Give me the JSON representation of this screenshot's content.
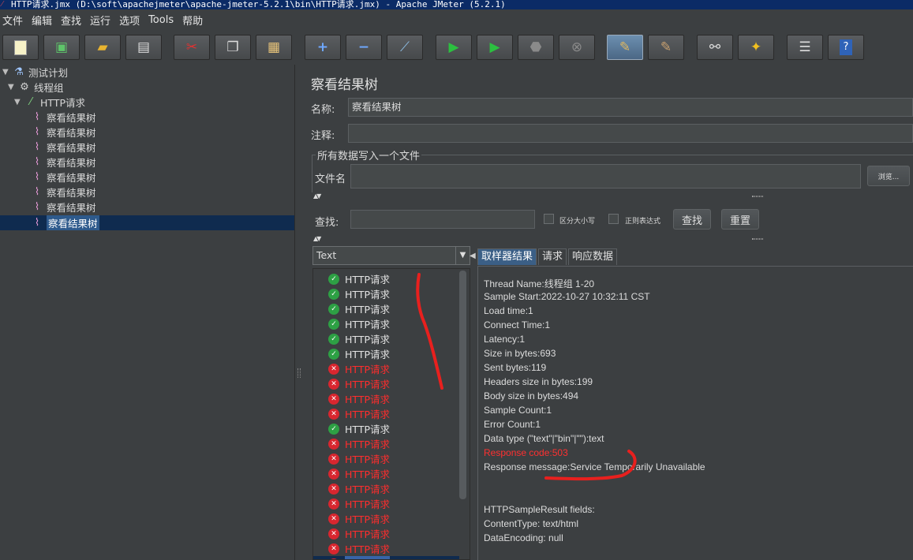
{
  "window": {
    "title": "HTTP请求.jmx (D:\\soft\\apachejmeter\\apache-jmeter-5.2.1\\bin\\HTTP请求.jmx) - Apache JMeter (5.2.1)"
  },
  "menu": [
    "文件",
    "编辑",
    "查找",
    "运行",
    "选项",
    "Tools",
    "帮助"
  ],
  "toolbar": {
    "icons": [
      "new-icon",
      "templates-icon",
      "open-icon",
      "save-icon",
      "cut-icon",
      "copy-icon",
      "paste-icon",
      "expand-icon",
      "collapse-icon",
      "toggle-icon",
      "start-icon",
      "start-no-pause-icon",
      "stop-icon",
      "shutdown-icon",
      "clear-icon",
      "clear-all-icon",
      "search-icon",
      "reset-search-icon",
      "function-helper-icon",
      "help-icon"
    ]
  },
  "tree": {
    "plan": "测试计划",
    "thread_group": "线程组",
    "sampler": "HTTP请求",
    "listeners": [
      "察看结果树",
      "察看结果树",
      "察看结果树",
      "察看结果树",
      "察看结果树",
      "察看结果树",
      "察看结果树",
      "察看结果树"
    ]
  },
  "panel": {
    "title": "察看结果树",
    "name_label": "名称:",
    "name_value": "察看结果树",
    "comment_label": "注释:",
    "comment_value": "",
    "file_section": "所有数据写入一个文件",
    "filename_label": "文件名",
    "filename_value": "",
    "browse_button": "浏览...",
    "search_label": "查找:",
    "search_value": "",
    "case_sensitive": "区分大小写",
    "regex": "正则表达式",
    "find_button": "查找",
    "reset_button": "重置",
    "renderer": "Text"
  },
  "results": [
    {
      "label": "HTTP请求",
      "ok": true
    },
    {
      "label": "HTTP请求",
      "ok": true
    },
    {
      "label": "HTTP请求",
      "ok": true
    },
    {
      "label": "HTTP请求",
      "ok": true
    },
    {
      "label": "HTTP请求",
      "ok": true
    },
    {
      "label": "HTTP请求",
      "ok": true
    },
    {
      "label": "HTTP请求",
      "ok": false
    },
    {
      "label": "HTTP请求",
      "ok": false
    },
    {
      "label": "HTTP请求",
      "ok": false
    },
    {
      "label": "HTTP请求",
      "ok": false
    },
    {
      "label": "HTTP请求",
      "ok": true
    },
    {
      "label": "HTTP请求",
      "ok": false
    },
    {
      "label": "HTTP请求",
      "ok": false
    },
    {
      "label": "HTTP请求",
      "ok": false
    },
    {
      "label": "HTTP请求",
      "ok": false
    },
    {
      "label": "HTTP请求",
      "ok": false
    },
    {
      "label": "HTTP请求",
      "ok": false
    },
    {
      "label": "HTTP请求",
      "ok": false
    },
    {
      "label": "HTTP请求",
      "ok": false
    },
    {
      "label": "HTTP请求",
      "ok": false,
      "selected": true
    }
  ],
  "tabs": [
    "取样器结果",
    "请求",
    "响应数据"
  ],
  "sample": {
    "lines": [
      {
        "text": "Thread Name:线程组 1-20"
      },
      {
        "text": "Sample Start:2022-10-27 10:32:11 CST"
      },
      {
        "text": "Load time:1"
      },
      {
        "text": "Connect Time:1"
      },
      {
        "text": "Latency:1"
      },
      {
        "text": "Size in bytes:693"
      },
      {
        "text": "Sent bytes:119"
      },
      {
        "text": "Headers size in bytes:199"
      },
      {
        "text": "Body size in bytes:494"
      },
      {
        "text": "Sample Count:1"
      },
      {
        "text": "Error Count:1"
      },
      {
        "text": "Data type (\"text\"|\"bin\"|\"\"):text"
      },
      {
        "text": "Response code:503",
        "red": true
      },
      {
        "text": "Response message:Service Temporarily Unavailable"
      },
      {
        "text": ""
      },
      {
        "text": ""
      },
      {
        "text": "HTTPSampleResult fields:"
      },
      {
        "text": "ContentType: text/html"
      },
      {
        "text": "DataEncoding: null"
      }
    ]
  },
  "colors": {
    "ok": "#2da044",
    "error": "#ff2d2d",
    "selection": "#0f2b4f",
    "annotation": "#e8201e"
  }
}
